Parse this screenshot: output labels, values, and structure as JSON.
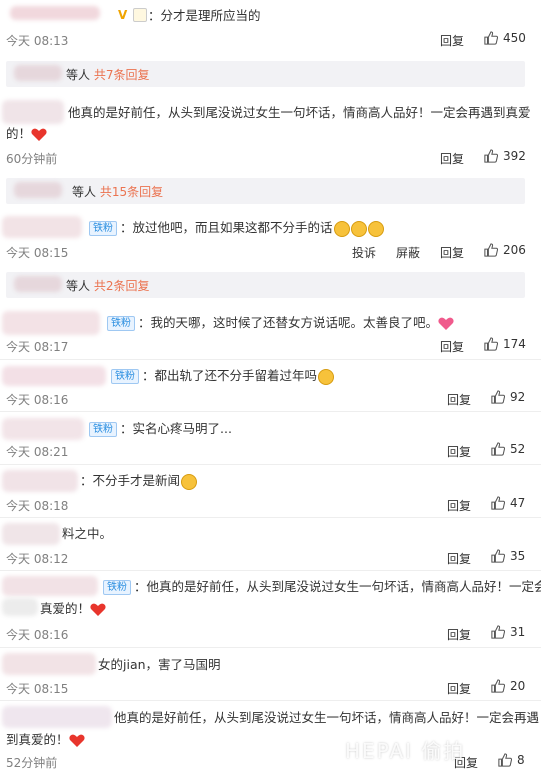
{
  "comments": [
    {
      "text": "：分才是理所应当的",
      "time": "今天 08:13",
      "actions": [
        "回复"
      ],
      "likes": "450"
    },
    {
      "text1": "他真的是好前任，从头到尾没说过女生一句坏话，情商高人品好！一定会再遇到真爱",
      "text2": "的！",
      "time": "60分钟前",
      "actions": [
        "回复"
      ],
      "likes": "392"
    },
    {
      "badge": "铁粉",
      "text": "：放过他吧，而且如果这都不分手的话",
      "time": "今天 08:15",
      "actions": [
        "投诉",
        "屏蔽",
        "回复"
      ],
      "likes": "206"
    },
    {
      "badge": "铁粉",
      "text": "：我的天哪，这时候了还替女方说话呢。太善良了吧。",
      "time": "今天 08:17",
      "actions": [
        "回复"
      ],
      "likes": "174"
    },
    {
      "badge": "铁粉",
      "text": "：都出轨了还不分手留着过年吗",
      "time": "今天 08:16",
      "actions": [
        "回复"
      ],
      "likes": "92"
    },
    {
      "badge": "铁粉",
      "text": "：实名心疼马明了...",
      "time": "今天 08:21",
      "actions": [
        "回复"
      ],
      "likes": "52"
    },
    {
      "text": "：不分手才是新闻",
      "time": "今天 08:18",
      "actions": [
        "回复"
      ],
      "likes": "47"
    },
    {
      "text": "料之中。",
      "time": "今天 08:12",
      "actions": [
        "回复"
      ],
      "likes": "35"
    },
    {
      "badge": "铁粉",
      "text1": "：他真的是好前任，从头到尾没说过女生一句坏话，情商高人品好！一定会",
      "text2": "真爱的！",
      "time": "今天 08:16",
      "actions": [
        "回复"
      ],
      "likes": "31"
    },
    {
      "text": "女的jian，害了马国明",
      "time": "今天 08:15",
      "actions": [
        "回复"
      ],
      "likes": "20"
    },
    {
      "text1": "他真的是好前任，从头到尾没说过女生一句坏话，情商高人品好！一定会再遇",
      "text2": "到真爱的！",
      "time": "52分钟前",
      "actions": [
        "回复"
      ],
      "likes": "8"
    }
  ],
  "reply_bars": [
    {
      "prefix": "等人",
      "count": "共7条回复"
    },
    {
      "prefix": "等人",
      "count": "共15条回复"
    },
    {
      "prefix": "等人",
      "count": "共2条回复"
    }
  ],
  "watermark": "HEPAI 偷拍"
}
